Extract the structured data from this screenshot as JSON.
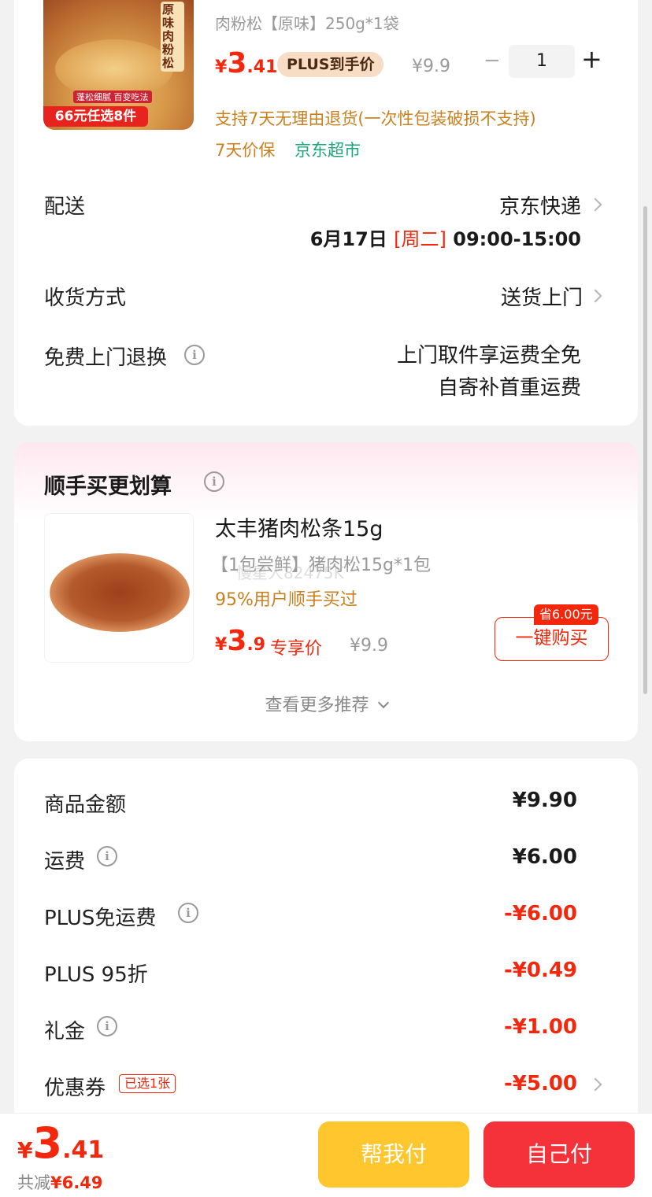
{
  "product": {
    "image_banner": "66元任选8件",
    "image_badge_1": "原味肉粉松",
    "image_badge_2": "蓬松细腻 百变吃法",
    "sku": "肉粉松【原味】250g*1袋",
    "price_symbol": "¥",
    "price_int": "3",
    "price_dec": ".41",
    "plus_tag": "PLUS到手价",
    "original_price": "¥9.9",
    "qty_minus": "−",
    "qty": "1",
    "qty_plus": "+",
    "return_policy": "支持7天无理由退货(一次性包装破损不支持)",
    "price_protect": "7天价保",
    "store": "京东超市"
  },
  "delivery": {
    "label": "配送",
    "carrier": "京东快递",
    "date": "6月17日",
    "weekday": "[周二]",
    "time": "09:00-15:00"
  },
  "receive": {
    "label": "收货方式",
    "value": "送货上门"
  },
  "free_return": {
    "label": "免费上门退换",
    "line1": "上门取件享运费全免",
    "line2": "自寄补首重运费"
  },
  "addon": {
    "title": "顺手买更划算",
    "name": "太丰猪肉松条15g",
    "sku": "【1包尝鲜】猪肉松15g*1包",
    "watermark": "慢星人82475K",
    "stat": "95%用户顺手买过",
    "price_symbol": "¥",
    "price_int": "3",
    "price_dec": ".9",
    "price_tag": "专享价",
    "original_price": "¥9.9",
    "save_badge": "省6.00元",
    "buy_button": "一键购买",
    "more": "查看更多推荐"
  },
  "summary": {
    "rows": [
      {
        "label": "商品金额",
        "value": "¥9.90"
      },
      {
        "label": "运费",
        "value": "¥6.00"
      },
      {
        "label": "PLUS免运费",
        "value": "-¥6.00"
      },
      {
        "label": "PLUS 95折",
        "value": "-¥0.49"
      },
      {
        "label": "礼金",
        "value": "-¥1.00"
      },
      {
        "label": "优惠券",
        "value": "-¥5.00"
      }
    ],
    "coupon_tag": "已选1张"
  },
  "footer": {
    "price_symbol": "¥",
    "price_int": "3",
    "price_dec": ".41",
    "saved_label": "共减",
    "saved_value": "¥6.49",
    "help_pay": "帮我付",
    "self_pay": "自己付"
  },
  "colors": {
    "accent": "#f2270c",
    "yellow_button": "#ffc62e",
    "red_button": "#f5323a",
    "orange_text": "#c9801f",
    "green_text": "#1aa77a"
  }
}
